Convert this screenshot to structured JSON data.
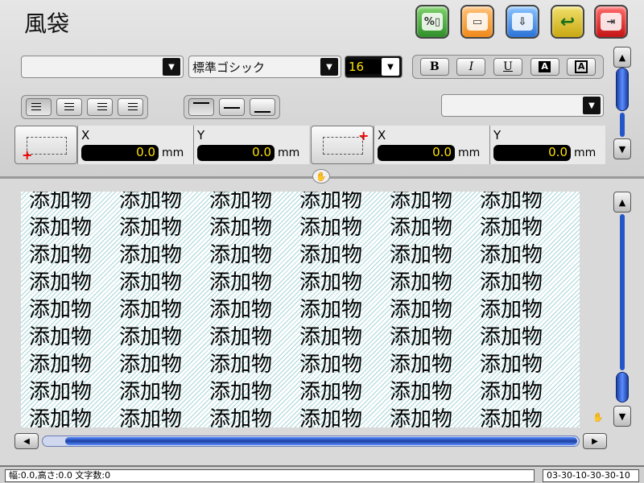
{
  "header": {
    "title": "風袋",
    "buttons": [
      {
        "name": "settings-icon",
        "color": "#3f9a33"
      },
      {
        "name": "comment-icon",
        "color": "#f08a1a"
      },
      {
        "name": "print-icon",
        "color": "#2a73d6"
      },
      {
        "name": "back-icon",
        "color": "#c9a812"
      },
      {
        "name": "exit-icon",
        "color": "#c41414"
      }
    ]
  },
  "toolbar": {
    "font_family_blank": "",
    "font_name": "標準ゴシック",
    "font_size": "16",
    "format": {
      "bold": "B",
      "italic": "I",
      "underline": "U",
      "box": "A",
      "inverse": "A"
    },
    "extra_dropdown": ""
  },
  "position": {
    "start": {
      "x_label": "X",
      "x_value": "0.0",
      "x_unit": "mm",
      "y_label": "Y",
      "y_value": "0.0",
      "y_unit": "mm"
    },
    "end": {
      "x_label": "X",
      "x_value": "0.0",
      "x_unit": "mm",
      "y_label": "Y",
      "y_value": "0.0",
      "y_unit": "mm"
    }
  },
  "preview": {
    "text": "添加物",
    "rows": 9,
    "cols": 6
  },
  "status": {
    "left": "幅:0.0,高さ:0.0 文字数:0",
    "right": "03-30-10-30-30-10"
  }
}
